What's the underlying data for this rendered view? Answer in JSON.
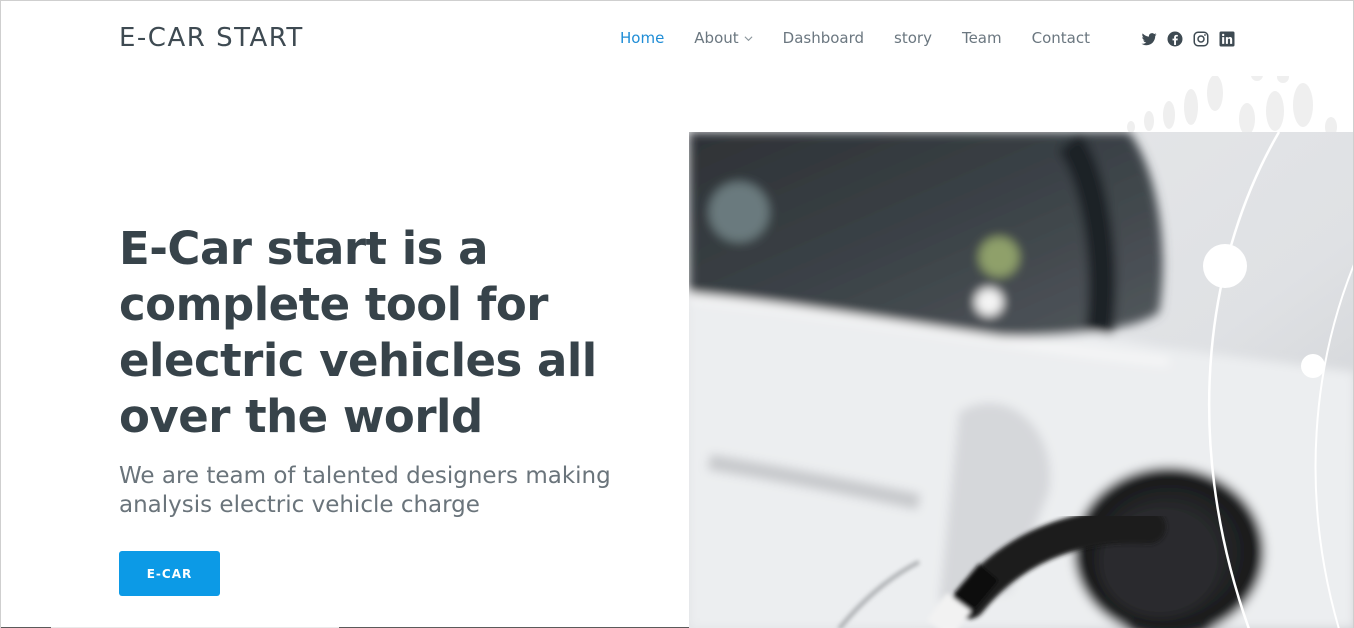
{
  "brand": {
    "logo_text": "E-CAR START"
  },
  "nav": {
    "items": [
      {
        "label": "Home",
        "active": true
      },
      {
        "label": "About",
        "has_dropdown": true
      },
      {
        "label": "Dashboard"
      },
      {
        "label": "story"
      },
      {
        "label": "Team"
      },
      {
        "label": "Contact"
      }
    ]
  },
  "social": {
    "icons": [
      "twitter-icon",
      "facebook-icon",
      "instagram-icon",
      "linkedin-icon"
    ]
  },
  "hero": {
    "title": "E-Car start is a complete tool for electric vehicles all over the world",
    "subtitle": "We are team of talented designers making analysis electric vehicle charge",
    "cta_label": "E-CAR",
    "image": "electric-car-charging-photo"
  },
  "colors": {
    "accent": "#1f8dd6",
    "button": "#0c9ae6",
    "heading": "#37434a",
    "text": "#6a747b"
  }
}
